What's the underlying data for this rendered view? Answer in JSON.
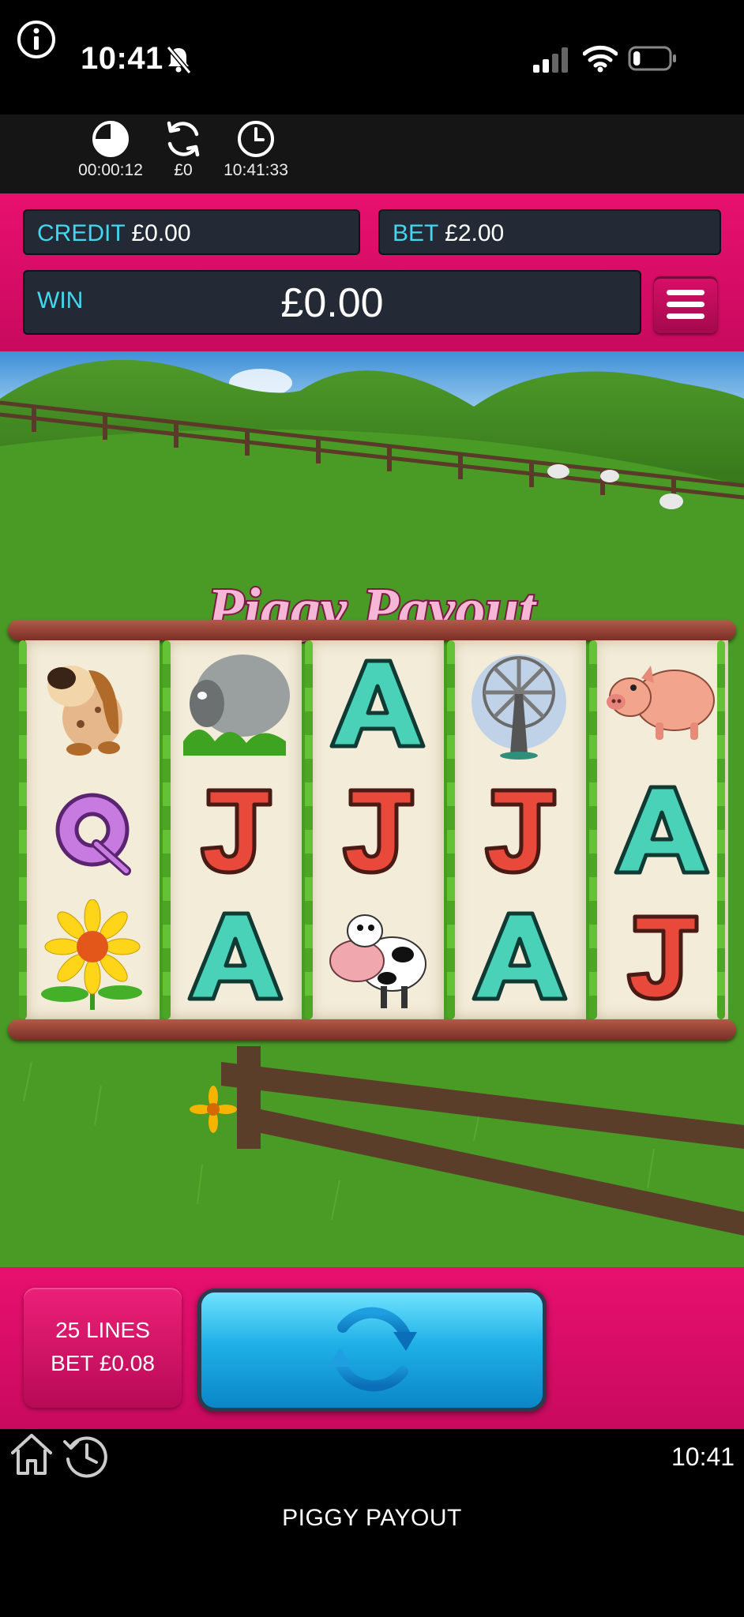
{
  "status_bar": {
    "time": "10:41",
    "silent": true,
    "battery_level": 0.2
  },
  "session": {
    "elapsed": "00:00:12",
    "net": "£0",
    "clock": "10:41:33"
  },
  "header": {
    "credit_label": "CREDIT",
    "credit_value": "£0.00",
    "bet_label": "BET",
    "bet_value": "£2.00",
    "win_label": "WIN",
    "win_value": "£0.00"
  },
  "game": {
    "logo_text": "Piggy Payout",
    "reels": [
      [
        "dog",
        "Q",
        "sunflower"
      ],
      [
        "sheep",
        "J",
        "A"
      ],
      [
        "A",
        "J",
        "cow"
      ],
      [
        "windmill",
        "J",
        "A"
      ],
      [
        "pig",
        "A",
        "J"
      ]
    ]
  },
  "controls": {
    "lines": "25 LINES",
    "bet": "BET £0.08"
  },
  "footer": {
    "time": "10:41",
    "title": "PIGGY PAYOUT"
  },
  "colors": {
    "pink": "#e8106f",
    "panel": "#232a36",
    "label_cyan": "#41d7ef",
    "spin_blue": "#1fb0e6"
  },
  "icons": [
    "bell-slash-icon",
    "signal-icon",
    "wifi-icon",
    "battery-icon",
    "info-icon",
    "timer-icon",
    "refresh-icon",
    "clock-icon",
    "hamburger-menu-icon",
    "spin-icon",
    "home-icon",
    "history-icon"
  ]
}
